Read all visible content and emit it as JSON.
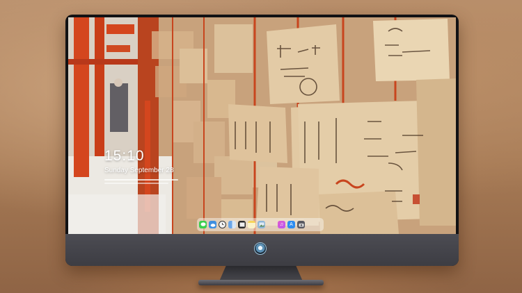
{
  "lock_screen": {
    "time": "15:10",
    "date": "Sunday September 28"
  },
  "dock": {
    "items": [
      {
        "icon": "messages-icon",
        "color": "#3ccf4e"
      },
      {
        "icon": "weather-icon",
        "color": "#3f8fe0"
      },
      {
        "icon": "clock-icon",
        "color": "#f2f2f2"
      },
      {
        "icon": "finder-icon",
        "color": "#6aa6e8"
      },
      {
        "icon": "clapper-icon",
        "color": "#2b2b2b"
      },
      {
        "icon": "notes-icon",
        "color": "#f6d55b"
      },
      {
        "icon": "photos-icon",
        "color": "#8fb6d8"
      },
      {
        "icon": "music-icon",
        "color": "#e05bd0"
      },
      {
        "icon": "app-store-icon",
        "color": "#2d8cf0"
      },
      {
        "icon": "camera-icon",
        "color": "#5a5a62"
      }
    ]
  },
  "colors": {
    "background": "#b88f6c",
    "monitor_bezel": "#121214",
    "monitor_chin": "#45454b",
    "torii_red": "#d4461e"
  }
}
